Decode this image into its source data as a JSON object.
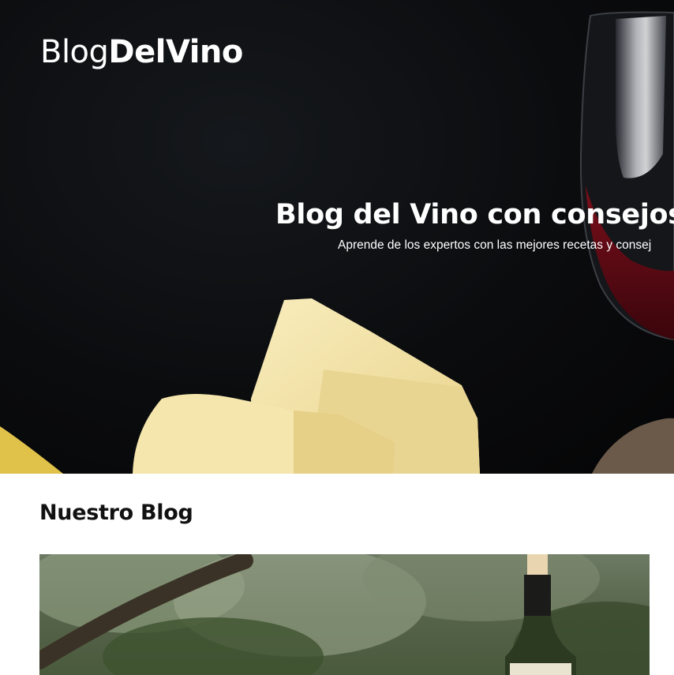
{
  "header": {
    "logo_light": "Blog",
    "logo_bold": "DelVino"
  },
  "hero": {
    "title": "Blog del Vino con consejos y c",
    "subtitle": "Aprende de los expertos con las mejores recetas y consej"
  },
  "blog": {
    "section_title": "Nuestro Blog"
  },
  "colors": {
    "hero_background": "#0b0c0e",
    "text_light": "#ffffff",
    "text_dark": "#111111",
    "wine": "#5a0a14",
    "cheese": "#f3e3a4"
  },
  "icons": {
    "hero_image": "wine-glass-and-cheese-photo",
    "blog_image": "wine-bottle-in-vineyard-photo"
  }
}
